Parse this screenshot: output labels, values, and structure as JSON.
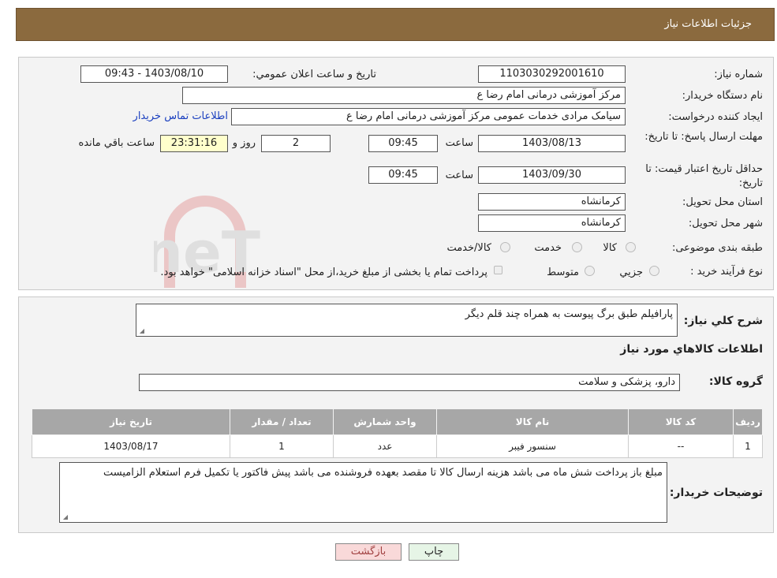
{
  "header": {
    "title": "جزئیات اطلاعات نیاز"
  },
  "fields": {
    "need_number_label": "شماره نیاز:",
    "need_number": "1103030292001610",
    "announce_label": "تاریخ و ساعت اعلان عمومي:",
    "announce_value": "1403/08/10 - 09:43",
    "buyer_org_label": "نام دستگاه خريدار:",
    "buyer_org": "مرکز آموزشی  درمانی امام رضا  ع",
    "creator_label": "ايجاد کننده درخواست:",
    "creator": "سیامک مرادی خدمات عمومی مرکز آموزشی  درمانی امام رضا  ع",
    "contact_link": "اطلاعات تماس خريدار",
    "reply_deadline_label": "مهلت ارسال پاسخ: تا تاريخ:",
    "reply_date": "1403/08/13",
    "time_label": "ساعت",
    "reply_time": "09:45",
    "days": "2",
    "days_label": "روز و",
    "remaining_time": "23:31:16",
    "remaining_label": "ساعت باقي مانده",
    "price_validity_label": "حداقل تاريخ اعتبار قيمت: تا تاريخ:",
    "price_date": "1403/09/30",
    "price_time": "09:45",
    "province_label": "استان محل تحويل:",
    "province": "کرمانشاه",
    "city_label": "شهر محل تحويل:",
    "city": "کرمانشاه",
    "category_label": "طبقه بندی موضوعی:",
    "category_options": [
      "کالا",
      "خدمت",
      "کالا/خدمت"
    ],
    "process_label": "نوع فرآيند خريد :",
    "process_options": [
      "جزيي",
      "متوسط"
    ],
    "process_note": "پرداخت تمام يا بخشی از مبلغ خريد،از محل \"اسناد خزانه اسلامی\" خواهد بود."
  },
  "description": {
    "label": "شرح كلي نياز:",
    "value": "پارافیلم طبق برگ پیوست به همراه چند قلم دیگر"
  },
  "goods": {
    "section_title": "اطلاعات كالاهاي مورد نياز",
    "group_label": "گروه کالا:",
    "group_value": "دارو، پزشکی و سلامت",
    "columns": [
      "رديف",
      "كد كالا",
      "نام كالا",
      "واحد شمارش",
      "تعداد / مقدار",
      "تاريخ نياز"
    ],
    "rows": [
      [
        "1",
        "--",
        "سنسور فیبر",
        "عدد",
        "1",
        "1403/08/17"
      ]
    ]
  },
  "buyer_notes": {
    "label": "توضيحات خريدار:",
    "value": "مبلغ باز پرداخت شش ماه می باشد هزینه ارسال کالا تا مقصد بعهده فروشنده می باشد پیش فاکتور یا تکمیل فرم استعلام الزامیست"
  },
  "buttons": {
    "print": "چاپ",
    "back": "بازگشت"
  },
  "watermark": "AriaTender.neT"
}
